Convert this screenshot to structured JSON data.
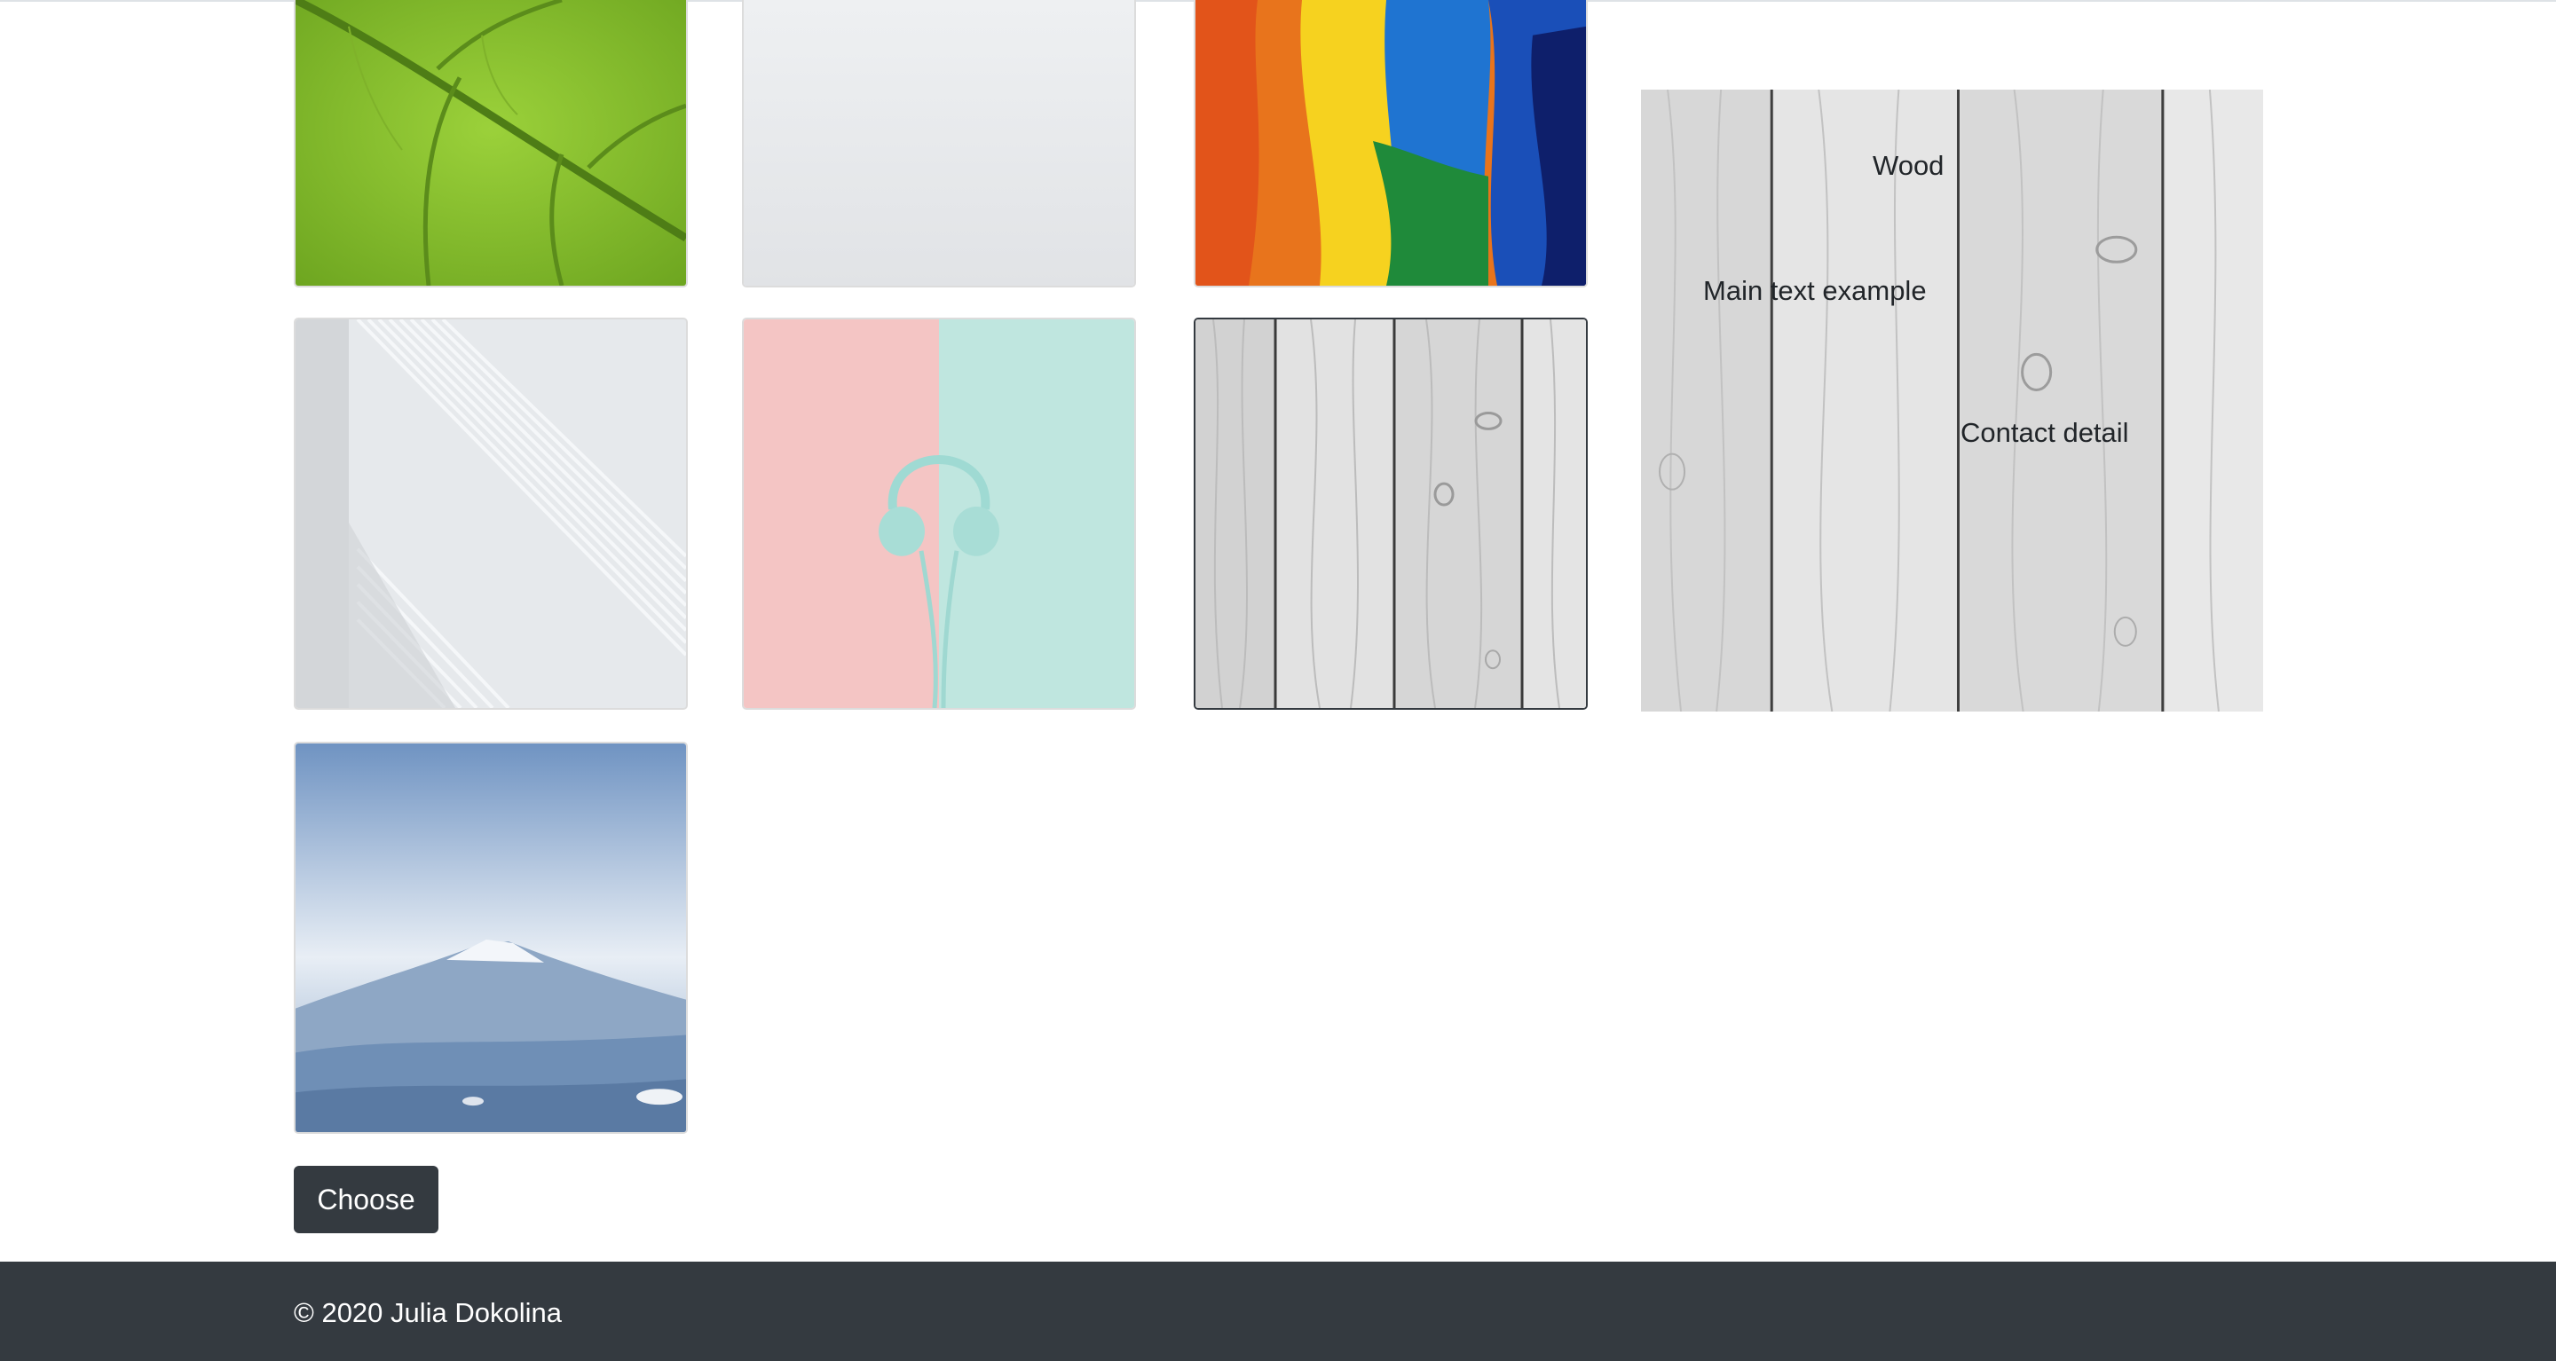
{
  "gallery": {
    "tiles": [
      {
        "name": "leaf",
        "selected": false
      },
      {
        "name": "white",
        "selected": false
      },
      {
        "name": "paint",
        "selected": false
      },
      {
        "name": "stripes",
        "selected": false
      },
      {
        "name": "headphones",
        "selected": false
      },
      {
        "name": "wood",
        "selected": true
      },
      {
        "name": "mountain",
        "selected": false
      }
    ]
  },
  "preview": {
    "title": "Wood",
    "main_text": "Main text example",
    "contact": "Contact detail"
  },
  "actions": {
    "choose_label": "Choose"
  },
  "footer": {
    "copyright": "© 2020 Julia Dokolina"
  },
  "colors": {
    "dark": "#343a40",
    "text": "#212529",
    "background": "#ffffff"
  }
}
